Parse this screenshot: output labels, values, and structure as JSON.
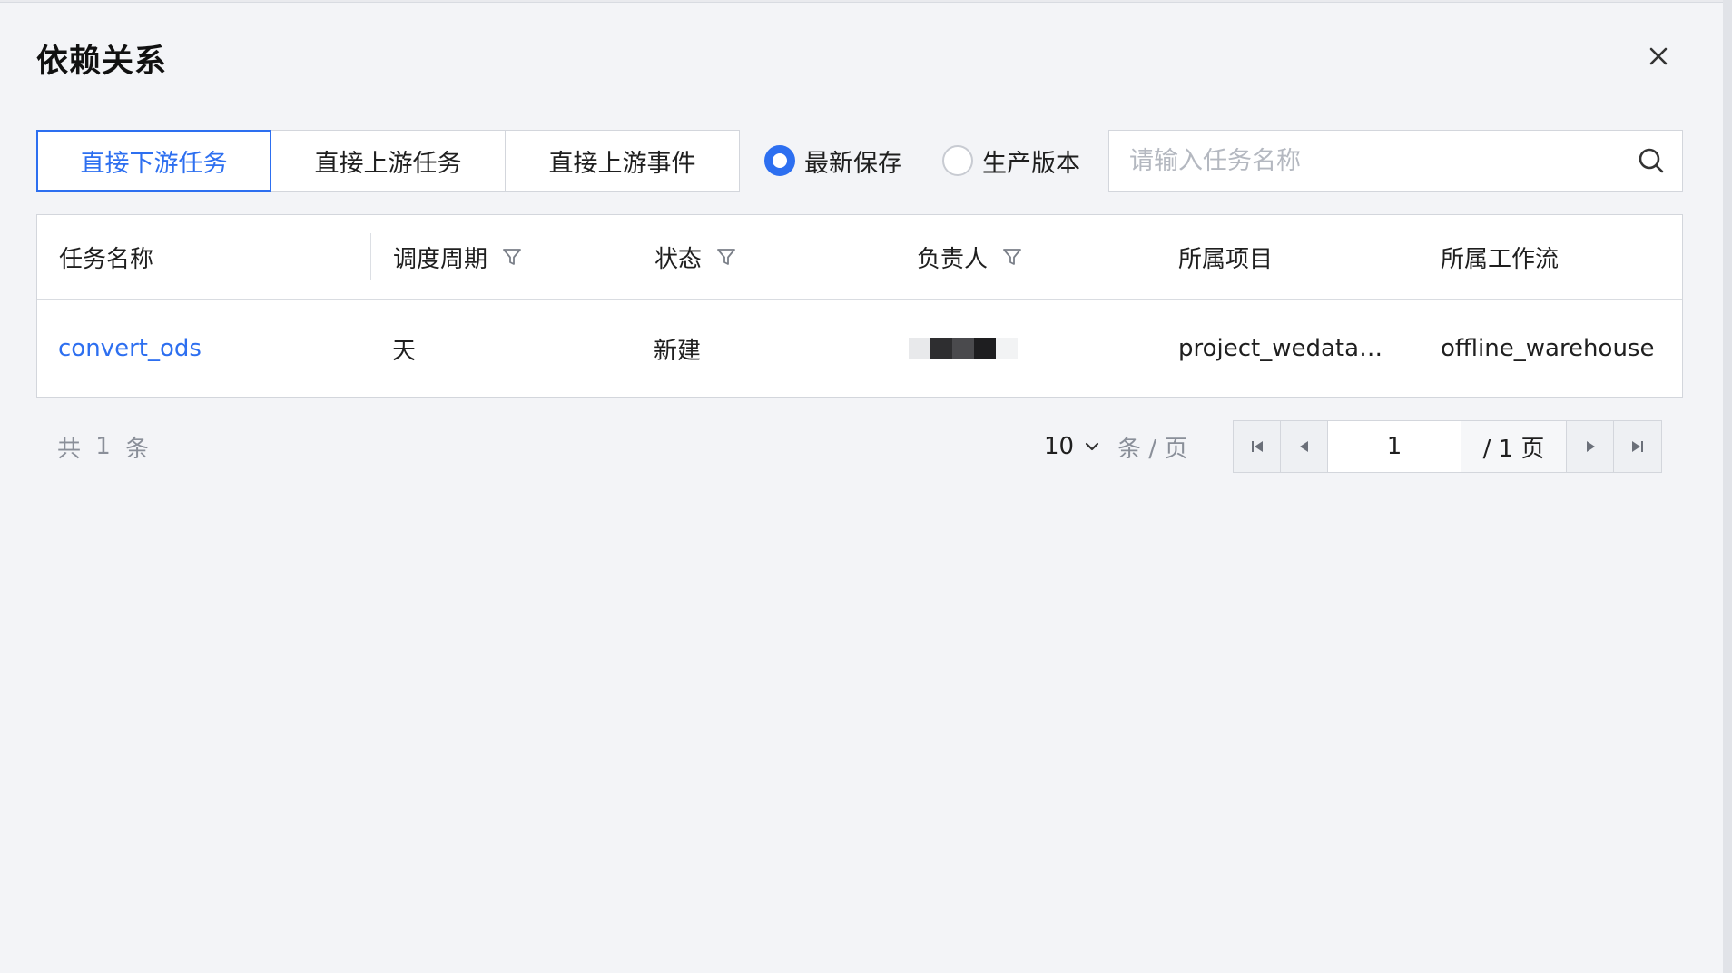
{
  "dialog": {
    "title": "依赖关系"
  },
  "tabs": [
    {
      "label": "直接下游任务",
      "active": true
    },
    {
      "label": "直接上游任务",
      "active": false
    },
    {
      "label": "直接上游事件",
      "active": false
    }
  ],
  "version_radio": {
    "options": [
      {
        "label": "最新保存",
        "checked": true
      },
      {
        "label": "生产版本",
        "checked": false
      }
    ]
  },
  "search": {
    "placeholder": "请输入任务名称",
    "value": ""
  },
  "table": {
    "columns": [
      {
        "label": "任务名称",
        "filter": false
      },
      {
        "label": "调度周期",
        "filter": true
      },
      {
        "label": "状态",
        "filter": true
      },
      {
        "label": "负责人",
        "filter": true
      },
      {
        "label": "所属项目",
        "filter": false
      },
      {
        "label": "所属工作流",
        "filter": false
      }
    ],
    "rows": [
      {
        "task_name": "convert_ods",
        "cycle": "天",
        "status": "新建",
        "owner": "",
        "project": "project_wedata…",
        "workflow": "offline_warehouse"
      }
    ]
  },
  "pagination": {
    "total_prefix": "共",
    "total_count": "1",
    "total_suffix": "条",
    "page_size": "10",
    "page_size_unit": "条 / 页",
    "current_page": "1",
    "total_pages_label": "/ 1 页"
  },
  "colors": {
    "accent": "#2d6ff0",
    "background": "#f3f4f7"
  }
}
